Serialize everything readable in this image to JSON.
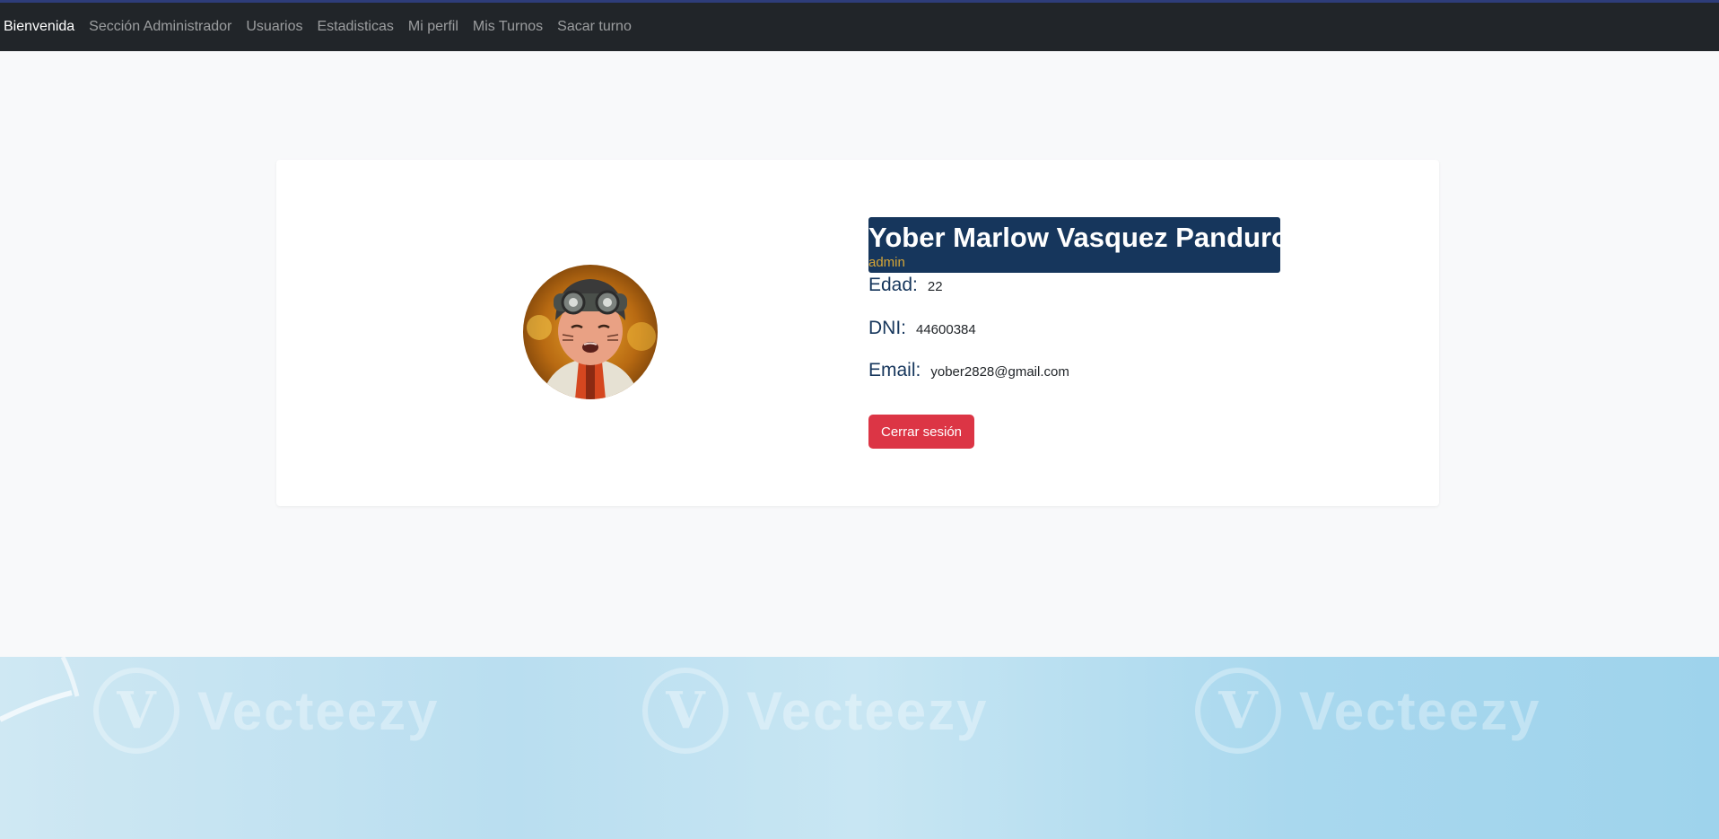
{
  "nav": {
    "items": [
      {
        "label": "Bienvenida",
        "active": true
      },
      {
        "label": "Sección Administrador",
        "active": false
      },
      {
        "label": "Usuarios",
        "active": false
      },
      {
        "label": "Estadisticas",
        "active": false
      },
      {
        "label": "Mi perfil",
        "active": false
      },
      {
        "label": "Mis Turnos",
        "active": false
      },
      {
        "label": "Sacar turno",
        "active": false
      }
    ]
  },
  "profile": {
    "name": "Yober Marlow Vasquez Panduro",
    "role": "admin",
    "age_label": "Edad:",
    "age_value": "22",
    "dni_label": "DNI:",
    "dni_value": "44600384",
    "email_label": "Email:",
    "email_value": "yober2828@gmail.com",
    "logout_label": "Cerrar sesión"
  },
  "footer": {
    "watermark_text": "Vecteezy",
    "watermark_logo": "V"
  },
  "colors": {
    "navbar_bg": "#212529",
    "name_block_bg": "#16365c",
    "role_color": "#d4a537",
    "logout_bg": "#dc3545"
  }
}
